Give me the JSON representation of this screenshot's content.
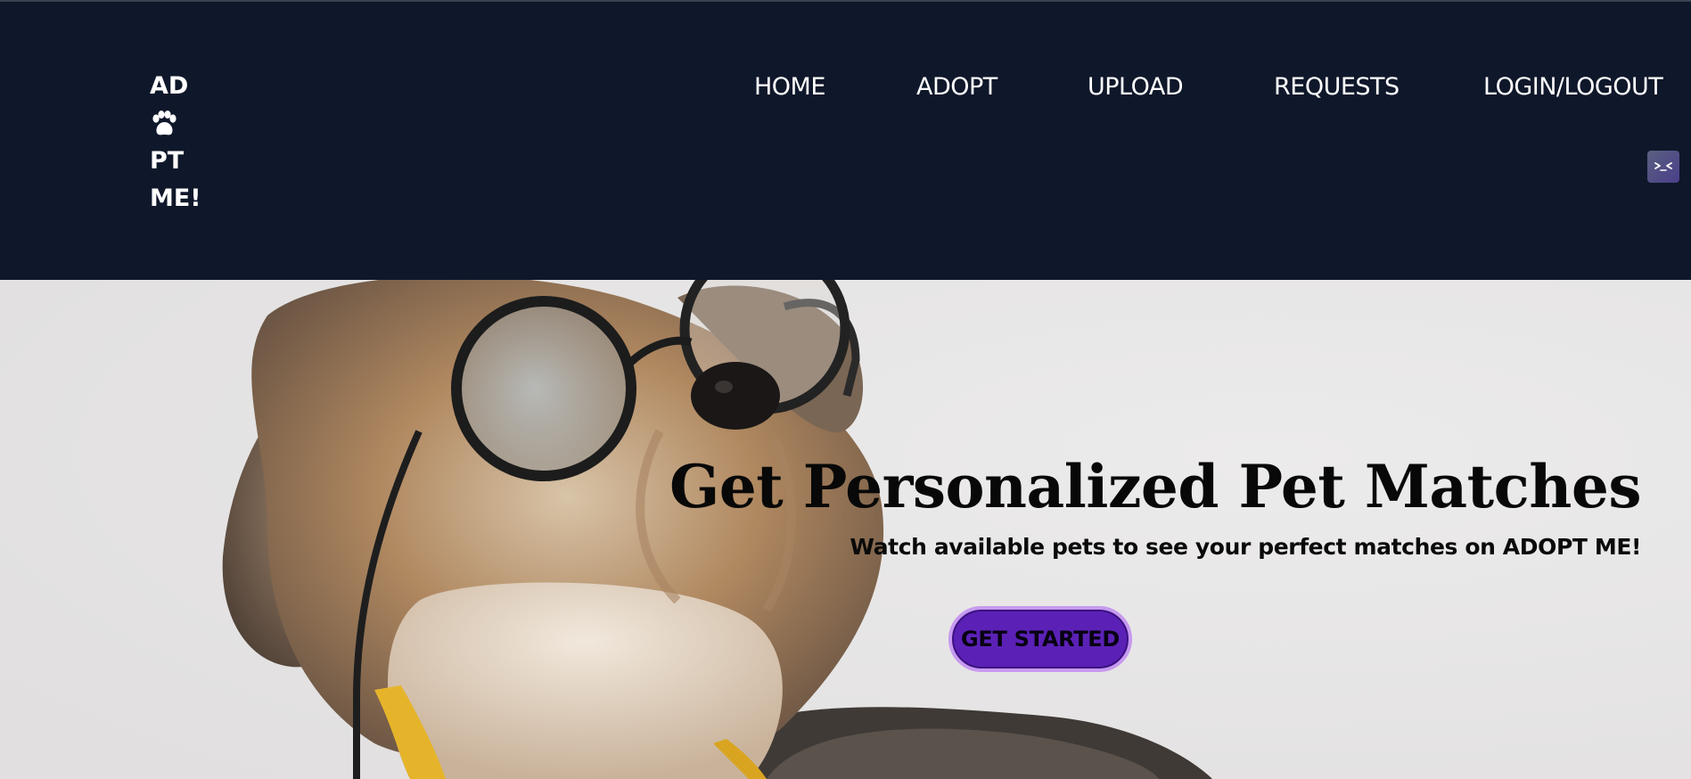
{
  "brand": {
    "logo_lines": [
      "AD",
      "PT",
      "ME!"
    ],
    "logo_icon": "paw-icon"
  },
  "nav": {
    "home": "HOME",
    "adopt": "ADOPT",
    "upload": "UPLOAD",
    "requests": "REQUESTS",
    "login": "LOGIN/LOGOUT"
  },
  "devtools": {
    "icon": "code-toggle-icon"
  },
  "hero": {
    "title": "Get Personalized Pet Matches",
    "subtitle": "Watch available pets to see your perfect matches on ADOPT ME!",
    "cta_label": "GET STARTED",
    "image": "dog-with-glasses-photo"
  },
  "colors": {
    "navbar_bg": "#0f172a",
    "hero_bg": "#e8e6e6",
    "cta_bg": "#5b21b6",
    "cta_border": "#c79af0"
  }
}
